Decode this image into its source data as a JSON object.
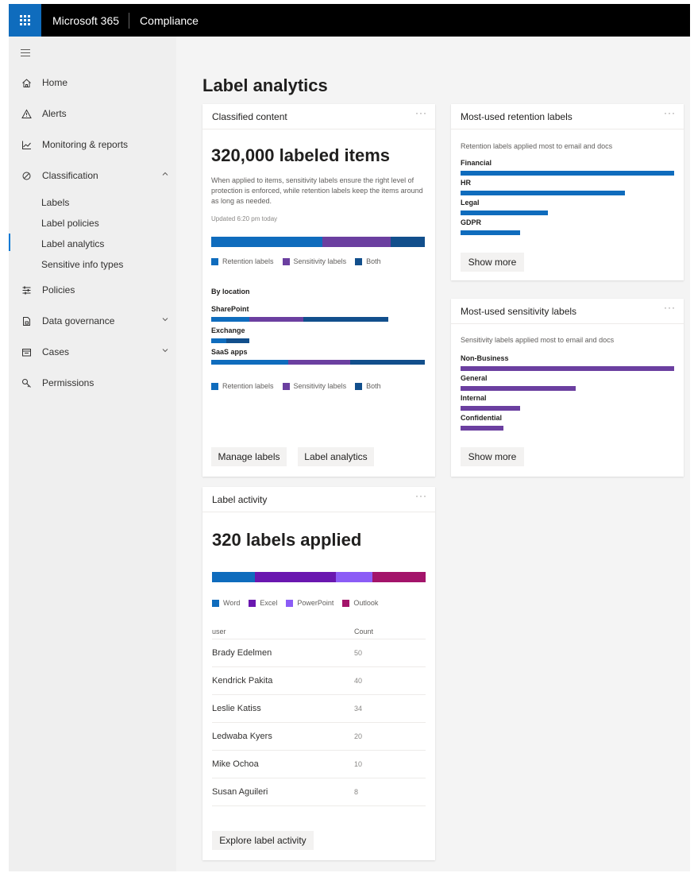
{
  "header": {
    "brand": "Microsoft 365",
    "app": "Compliance"
  },
  "nav": {
    "items": [
      {
        "label": "Home",
        "icon": "home-icon"
      },
      {
        "label": "Alerts",
        "icon": "warning-icon"
      },
      {
        "label": "Monitoring & reports",
        "icon": "chart-icon"
      },
      {
        "label": "Classification",
        "icon": "tag-icon"
      },
      {
        "label": "Policies",
        "icon": "sliders-icon"
      },
      {
        "label": "Data governance",
        "icon": "lock-document-icon"
      },
      {
        "label": "Cases",
        "icon": "briefcase-icon"
      },
      {
        "label": "Permissions",
        "icon": "key-icon"
      }
    ],
    "sub_items": [
      "Labels",
      "Label policies",
      "Label analytics",
      "Sensitive info types"
    ],
    "active_sub": "Label analytics"
  },
  "page": {
    "title": "Label analytics"
  },
  "colors": {
    "retention": "#0f6cbd",
    "sensitivity": "#6b3fa0",
    "both": "#124f8c",
    "word": "#0f6cbd",
    "excel": "#6a17b0",
    "powerpoint": "#8b5cf6",
    "outlook": "#a3146a",
    "accent": "#0078d4"
  },
  "classified": {
    "title": "Classified content",
    "more": "···",
    "headline": "320,000 labeled items",
    "description": "When applied to items, sensitivity labels ensure the right level of protection is enforced, while retention labels keep the items around as long as needed.",
    "updated": "Updated 6:20 pm today",
    "overall_split": [
      0.52,
      0.32,
      0.16
    ],
    "legend": [
      "Retention labels",
      "Sensitivity labels",
      "Both"
    ],
    "by_location_label": "By location",
    "locations": [
      {
        "name": "SharePoint",
        "split": [
          0.18,
          0.25,
          0.4
        ]
      },
      {
        "name": "Exchange",
        "split": [
          0.07,
          0.0,
          0.11
        ]
      },
      {
        "name": "SaaS apps",
        "split": [
          0.36,
          0.29,
          0.35
        ]
      }
    ],
    "buttons": [
      "Manage labels",
      "Label analytics"
    ]
  },
  "retention": {
    "title": "Most-used retention labels",
    "more": "···",
    "description": "Retention labels applied most to email and docs",
    "labels": [
      {
        "name": "Financial",
        "value": 1.0
      },
      {
        "name": "HR",
        "value": 0.77
      },
      {
        "name": "Legal",
        "value": 0.41
      },
      {
        "name": "GDPR",
        "value": 0.28
      }
    ],
    "button": "Show more"
  },
  "sensitivity": {
    "title": "Most-used sensitivity labels",
    "more": "···",
    "description": "Sensitivity labels applied most to email and docs",
    "labels": [
      {
        "name": "Non-Business",
        "value": 1.0
      },
      {
        "name": "General",
        "value": 0.54
      },
      {
        "name": "Internal",
        "value": 0.28
      },
      {
        "name": "Confidential",
        "value": 0.2
      }
    ],
    "button": "Show more"
  },
  "activity": {
    "title": "Label activity",
    "more": "···",
    "headline": "320 labels applied",
    "split": [
      0.2,
      0.38,
      0.17,
      0.25
    ],
    "legend": [
      "Word",
      "Excel",
      "PowerPoint",
      "Outlook"
    ],
    "columns": [
      "user",
      "Count"
    ],
    "rows": [
      {
        "user": "Brady Edelmen",
        "count": "50"
      },
      {
        "user": "Kendrick Pakita",
        "count": "40"
      },
      {
        "user": "Leslie Katiss",
        "count": "34"
      },
      {
        "user": "Ledwaba Kyers",
        "count": "20"
      },
      {
        "user": "Mike Ochoa",
        "count": "10"
      },
      {
        "user": "Susan Aguileri",
        "count": "8"
      }
    ],
    "button": "Explore label activity"
  }
}
